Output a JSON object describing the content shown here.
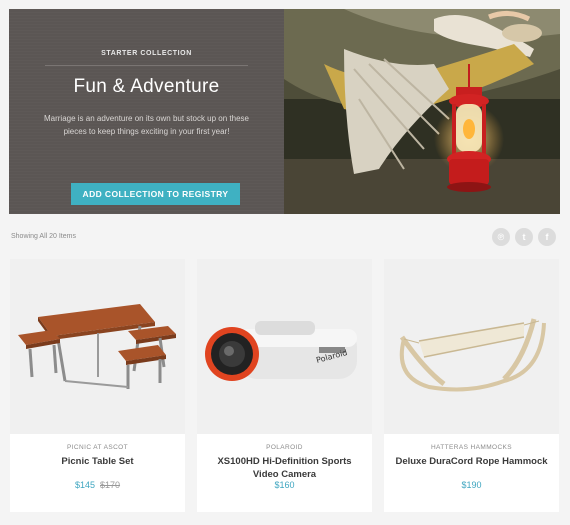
{
  "hero": {
    "eyebrow": "STARTER COLLECTION",
    "title": "Fun & Adventure",
    "description": "Marriage is an adventure on its own but stock up on these pieces to keep things exciting in your first year!",
    "cta_label": "ADD COLLECTION TO REGISTRY"
  },
  "toolbar": {
    "count_text": "Showing All 20 Items",
    "share_icons": [
      {
        "icon": "pinterest-icon",
        "glyph": "℗"
      },
      {
        "icon": "twitter-icon",
        "glyph": "t"
      },
      {
        "icon": "facebook-icon",
        "glyph": "f"
      }
    ]
  },
  "products": [
    {
      "brand": "PICNIC AT ASCOT",
      "name": "Picnic Table Set",
      "price": "$145",
      "old_price": "$170"
    },
    {
      "brand": "POLAROID",
      "name": "XS100HD Hi-Definition Sports Video Camera",
      "price": "$160",
      "old_price": ""
    },
    {
      "brand": "HATTERAS HAMMOCKS",
      "name": "Deluxe DuraCord Rope Hammock",
      "price": "$190",
      "old_price": ""
    }
  ],
  "colors": {
    "accent": "#3fb1c2",
    "price": "#3fa6c0",
    "hero_panel": "#5b5654",
    "page_bg": "#f4f4f4"
  }
}
